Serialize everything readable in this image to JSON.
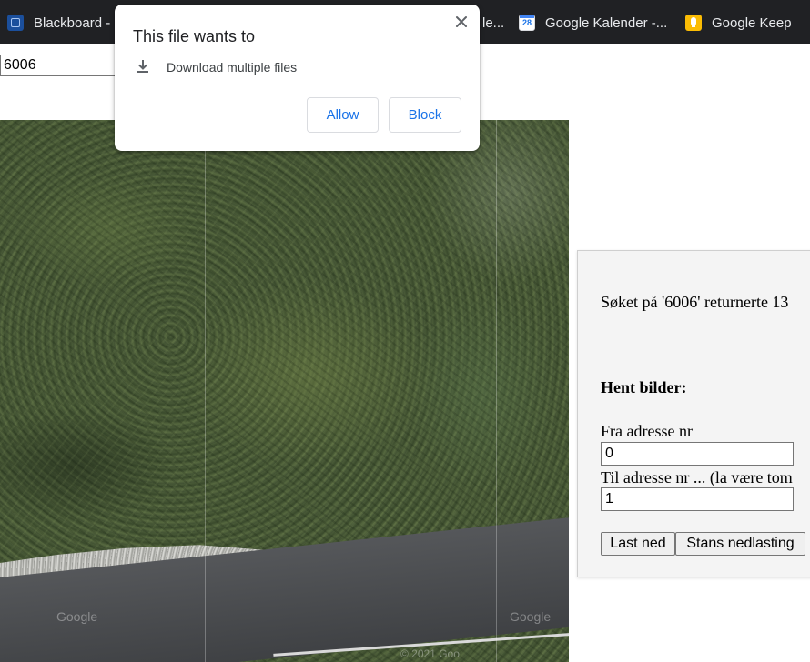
{
  "bookmarks": [
    {
      "label": "Blackboard -",
      "icon": "blackboard-icon"
    },
    {
      "label": "le...",
      "icon": "none"
    },
    {
      "label": "Google Kalender -...",
      "icon": "google-calendar-icon",
      "badge": "28"
    },
    {
      "label": "Google Keep",
      "icon": "google-keep-icon"
    }
  ],
  "search": {
    "value": "6006"
  },
  "map": {
    "watermark_left": "Google",
    "watermark_right": "Google",
    "copyright": "© 2021 Goo"
  },
  "panel": {
    "result_text": "Søket på '6006' returnerte 13",
    "heading": "Hent bilder:",
    "from_label": "Fra adresse nr",
    "from_value": "0",
    "to_label": "Til adresse nr ... (la være tom",
    "to_value": "1",
    "download_button": "Last ned",
    "stop_button": "Stans nedlasting"
  },
  "popup": {
    "title": "This file wants to",
    "permission": "Download multiple files",
    "allow_button": "Allow",
    "block_button": "Block",
    "colors": {
      "accent": "#1a73e8"
    }
  }
}
